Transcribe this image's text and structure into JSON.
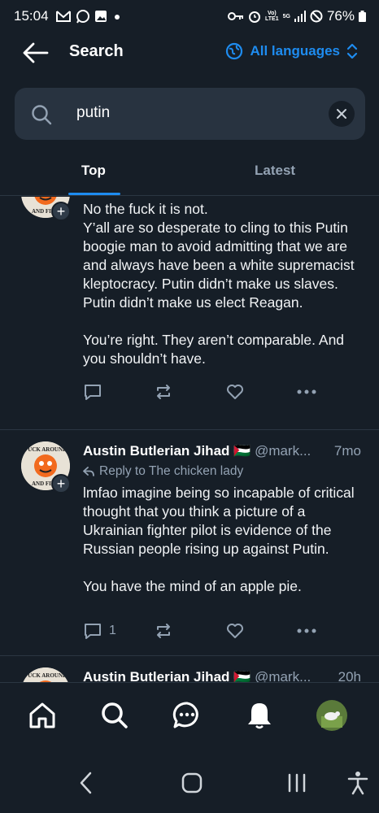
{
  "status": {
    "time": "15:04",
    "left_icons": [
      "gmail-icon",
      "whatsapp-icon",
      "gallery-icon",
      "dot-icon"
    ],
    "right_icons": [
      "key-icon",
      "alarm-icon",
      "volte-icon",
      "5g-icon",
      "signal-icon",
      "dnd-icon"
    ],
    "volte": "Vo)) LTE1",
    "net": "5G",
    "battery": "76%"
  },
  "header": {
    "title": "Search",
    "language_label": "All languages"
  },
  "search": {
    "value": "putin"
  },
  "tabs": [
    {
      "label": "Top",
      "active": true
    },
    {
      "label": "Latest",
      "active": false
    }
  ],
  "posts": [
    {
      "paragraphs": [
        "No the fuck it is not.\nY’all are so desperate to cling to this Putin boogie man to avoid admitting that we are and always have been a white supremacist kleptocracy. Putin didn’t make us slaves. Putin didn’t make us elect Reagan.",
        "You’re right. They aren’t comparable. And you shouldn’t have."
      ],
      "reply_count": ""
    },
    {
      "author": "Austin Butlerian Jihad",
      "flag": "🇵🇸",
      "handle": "@mark...",
      "time": "7mo",
      "reply_to": "Reply to The chicken lady",
      "paragraphs": [
        "lmfao imagine being so incapable of critical thought that you think a picture of a Ukrainian fighter pilot is evidence of the Russian people rising up against Putin.",
        "You have the mind of an apple pie."
      ],
      "reply_count": "1"
    },
    {
      "author": "Austin Butlerian Jihad",
      "flag": "🇵🇸",
      "handle": "@mark...",
      "time": "20h"
    }
  ],
  "avatar_text": "FUCK AROUND AND FIND OUT",
  "bottom_nav": [
    "home-icon",
    "search-icon",
    "chat-icon",
    "bell-icon",
    "profile-avatar"
  ],
  "system_nav": [
    "back-icon",
    "home-circle-icon",
    "recents-icon",
    "accessibility-icon"
  ],
  "colors": {
    "background": "#161e27",
    "accent": "#1e8cf0",
    "muted": "#93a2b3",
    "surface": "#283340"
  }
}
